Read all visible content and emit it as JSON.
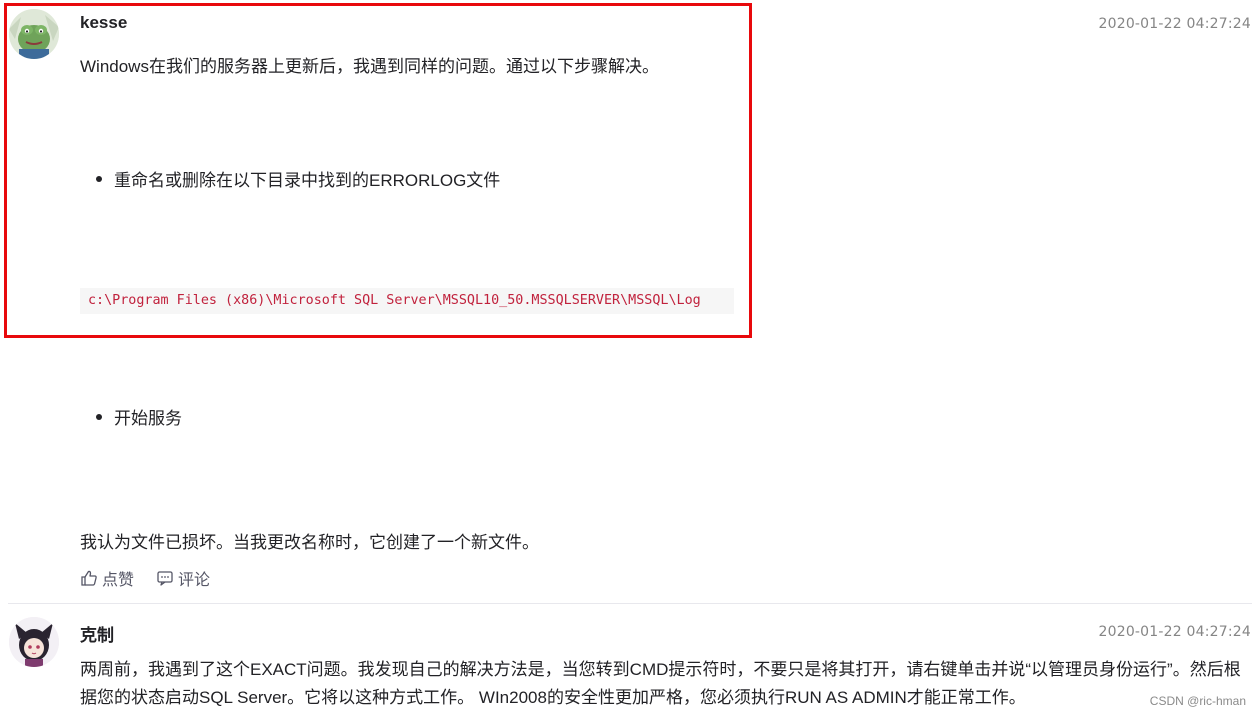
{
  "comment1": {
    "username": "kesse",
    "timestamp": "2020-01-22 04:27:24",
    "intro": "Windows在我们的服务器上更新后，我遇到同样的问题。通过以下步骤解决。",
    "bullet1": "重命名或删除在以下目录中找到的ERRORLOG文件",
    "code": "c:\\Program Files (x86)\\Microsoft SQL Server\\MSSQL10_50.MSSQLSERVER\\MSSQL\\Log",
    "bullet2": "开始服务",
    "conclusion": "我认为文件已损坏。当我更改名称时，它创建了一个新文件。",
    "like_label": "点赞",
    "comment_label": "评论"
  },
  "comment2": {
    "username": "克制",
    "timestamp": "2020-01-22 04:27:24",
    "text": "两周前，我遇到了这个EXACT问题。我发现自己的解决方法是，当您转到CMD提示符时，不要只是将其打开，请右键单击并说“以管理员身份运行”。然后根据您的状态启动SQL Server。它将以这种方式工作。 WIn2008的安全性更加严格，您必须执行RUN AS ADMIN才能正常工作。"
  },
  "watermark": "CSDN @ric-hman",
  "colors": {
    "highlight_border": "#e8090c",
    "code_text": "#c1223d",
    "code_bg": "#f6f6f6"
  },
  "icons": {
    "like": "thumbs-up-icon",
    "comment": "comment-icon"
  }
}
